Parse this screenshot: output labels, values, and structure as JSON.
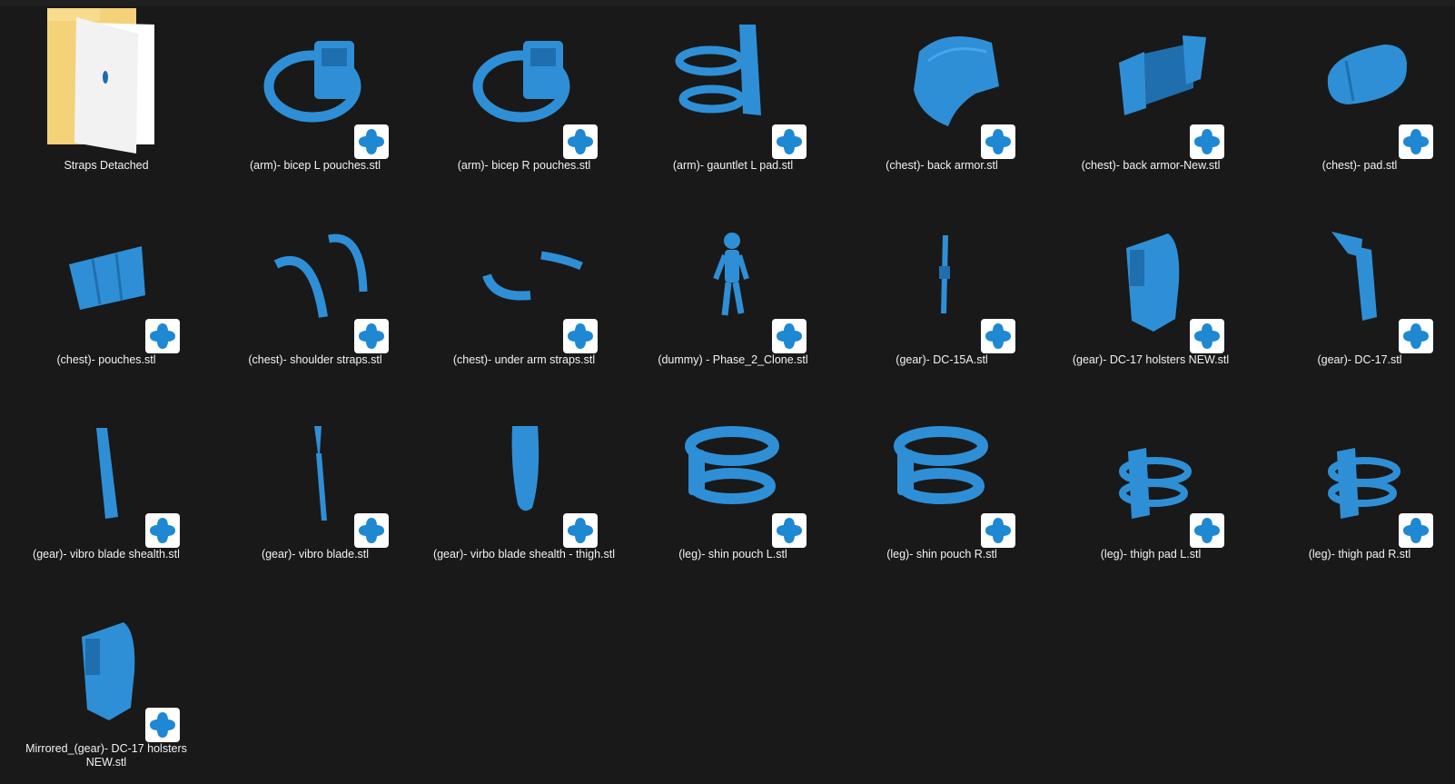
{
  "files": [
    {
      "name": "Straps Detached",
      "icon": "folder-icon"
    },
    {
      "name": "(arm)- bicep L pouches.stl",
      "icon": "bicep-pouches-model-icon"
    },
    {
      "name": "(arm)- bicep R pouches.stl",
      "icon": "bicep-pouches-model-icon"
    },
    {
      "name": "(arm)- gauntlet L pad.stl",
      "icon": "gauntlet-pad-model-icon"
    },
    {
      "name": "(chest)- back armor.stl",
      "icon": "back-armor-model-icon"
    },
    {
      "name": "(chest)- back armor-New.stl",
      "icon": "back-armor-new-model-icon"
    },
    {
      "name": "(chest)- pad.stl",
      "icon": "chest-pad-model-icon"
    },
    {
      "name": "(chest)- pouches.stl",
      "icon": "chest-pouches-model-icon"
    },
    {
      "name": "(chest)- shoulder straps.stl",
      "icon": "shoulder-straps-model-icon"
    },
    {
      "name": "(chest)- under arm straps.stl",
      "icon": "under-arm-straps-model-icon"
    },
    {
      "name": "(dummy) - Phase_2_Clone.stl",
      "icon": "clone-dummy-model-icon"
    },
    {
      "name": "(gear)- DC-15A.stl",
      "icon": "rifle-model-icon"
    },
    {
      "name": "(gear)- DC-17 holsters NEW.stl",
      "icon": "holster-model-icon"
    },
    {
      "name": "(gear)- DC-17.stl",
      "icon": "pistol-model-icon"
    },
    {
      "name": "(gear)- vibro blade shealth.stl",
      "icon": "sheath-model-icon"
    },
    {
      "name": "(gear)- vibro blade.stl",
      "icon": "blade-model-icon"
    },
    {
      "name": "(gear)- virbo blade shealth - thigh.stl",
      "icon": "thigh-sheath-model-icon"
    },
    {
      "name": "(leg)- shin pouch L.stl",
      "icon": "shin-pouch-model-icon"
    },
    {
      "name": "(leg)- shin pouch R.stl",
      "icon": "shin-pouch-model-icon"
    },
    {
      "name": "(leg)- thigh pad L.stl",
      "icon": "thigh-pad-model-icon"
    },
    {
      "name": "(leg)- thigh pad R.stl",
      "icon": "thigh-pad-model-icon"
    },
    {
      "name": "Mirrored_(gear)- DC-17 holsters NEW.stl",
      "icon": "holster-model-icon"
    }
  ],
  "colors": {
    "background": "#191919",
    "model": "#2f8fd6",
    "badge": "#1e88d2",
    "folder": "#f4d27a"
  },
  "badge_icon": "3d-viewer-badge-icon"
}
